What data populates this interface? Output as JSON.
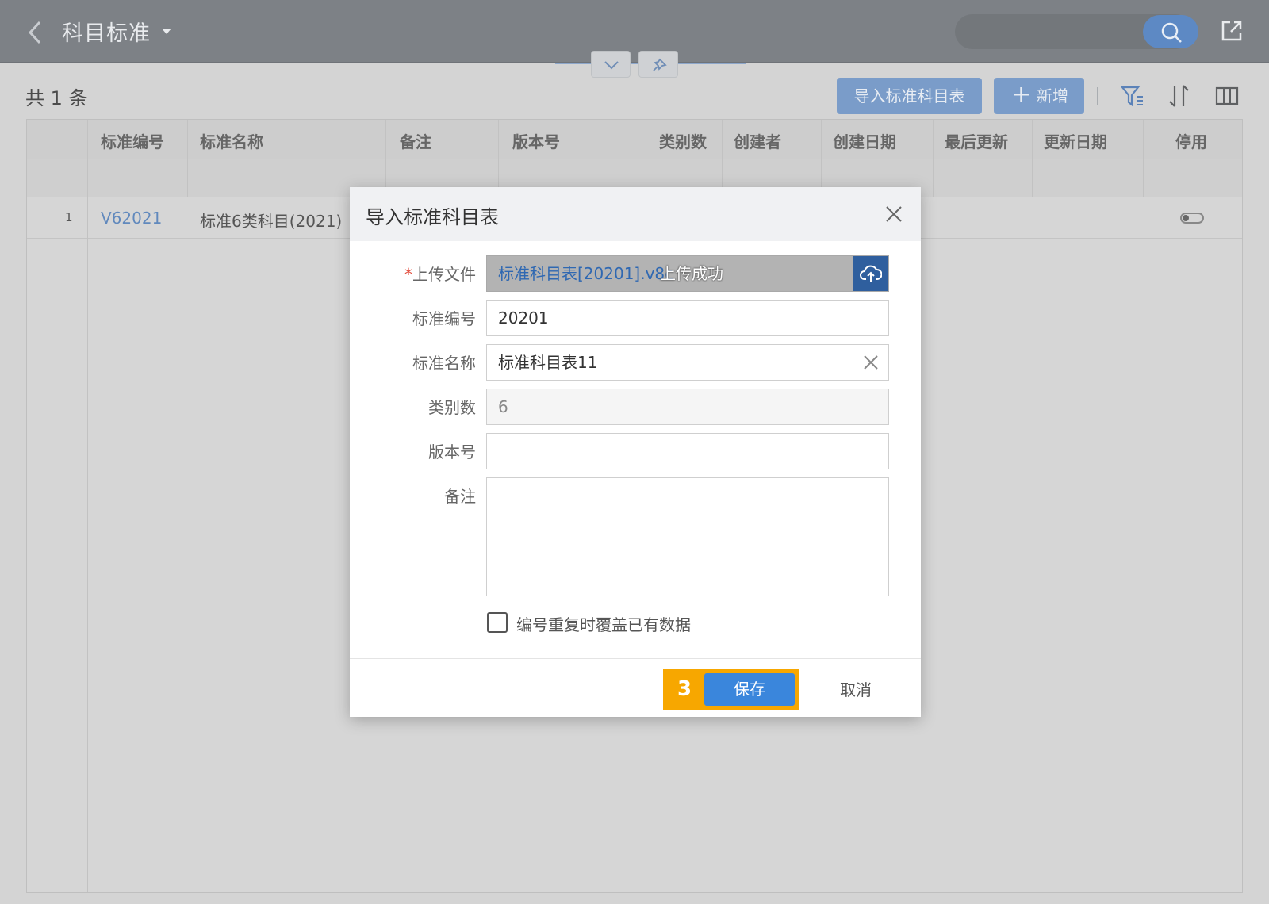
{
  "header": {
    "title": "科目标准"
  },
  "toolbar": {
    "count_label": "共 1 条",
    "import_label": "导入标准科目表",
    "add_label": "新增"
  },
  "table": {
    "columns": [
      "标准编号",
      "标准名称",
      "备注",
      "版本号",
      "类别数",
      "创建者",
      "创建日期",
      "最后更新",
      "更新日期",
      "停用"
    ],
    "rows": [
      {
        "index": "1",
        "code": "V62021",
        "name": "标准6类科目(2021)"
      }
    ]
  },
  "dialog": {
    "title": "导入标准科目表",
    "upload_label": "上传文件",
    "upload_filename": "标准科目表[20201].v8c",
    "upload_status": "上传成功",
    "code_label": "标准编号",
    "code_value": "20201",
    "name_label": "标准名称",
    "name_value": "标准科目表11",
    "category_label": "类别数",
    "category_value": "6",
    "version_label": "版本号",
    "version_value": "",
    "remark_label": "备注",
    "remark_value": "",
    "overwrite_label": "编号重复时覆盖已有数据",
    "step_badge": "3",
    "save_label": "保存",
    "cancel_label": "取消"
  },
  "colors": {
    "topbar": "#7d8186",
    "accent": "#3a86dc",
    "highlight": "#f7a700",
    "link": "#6189bd"
  }
}
